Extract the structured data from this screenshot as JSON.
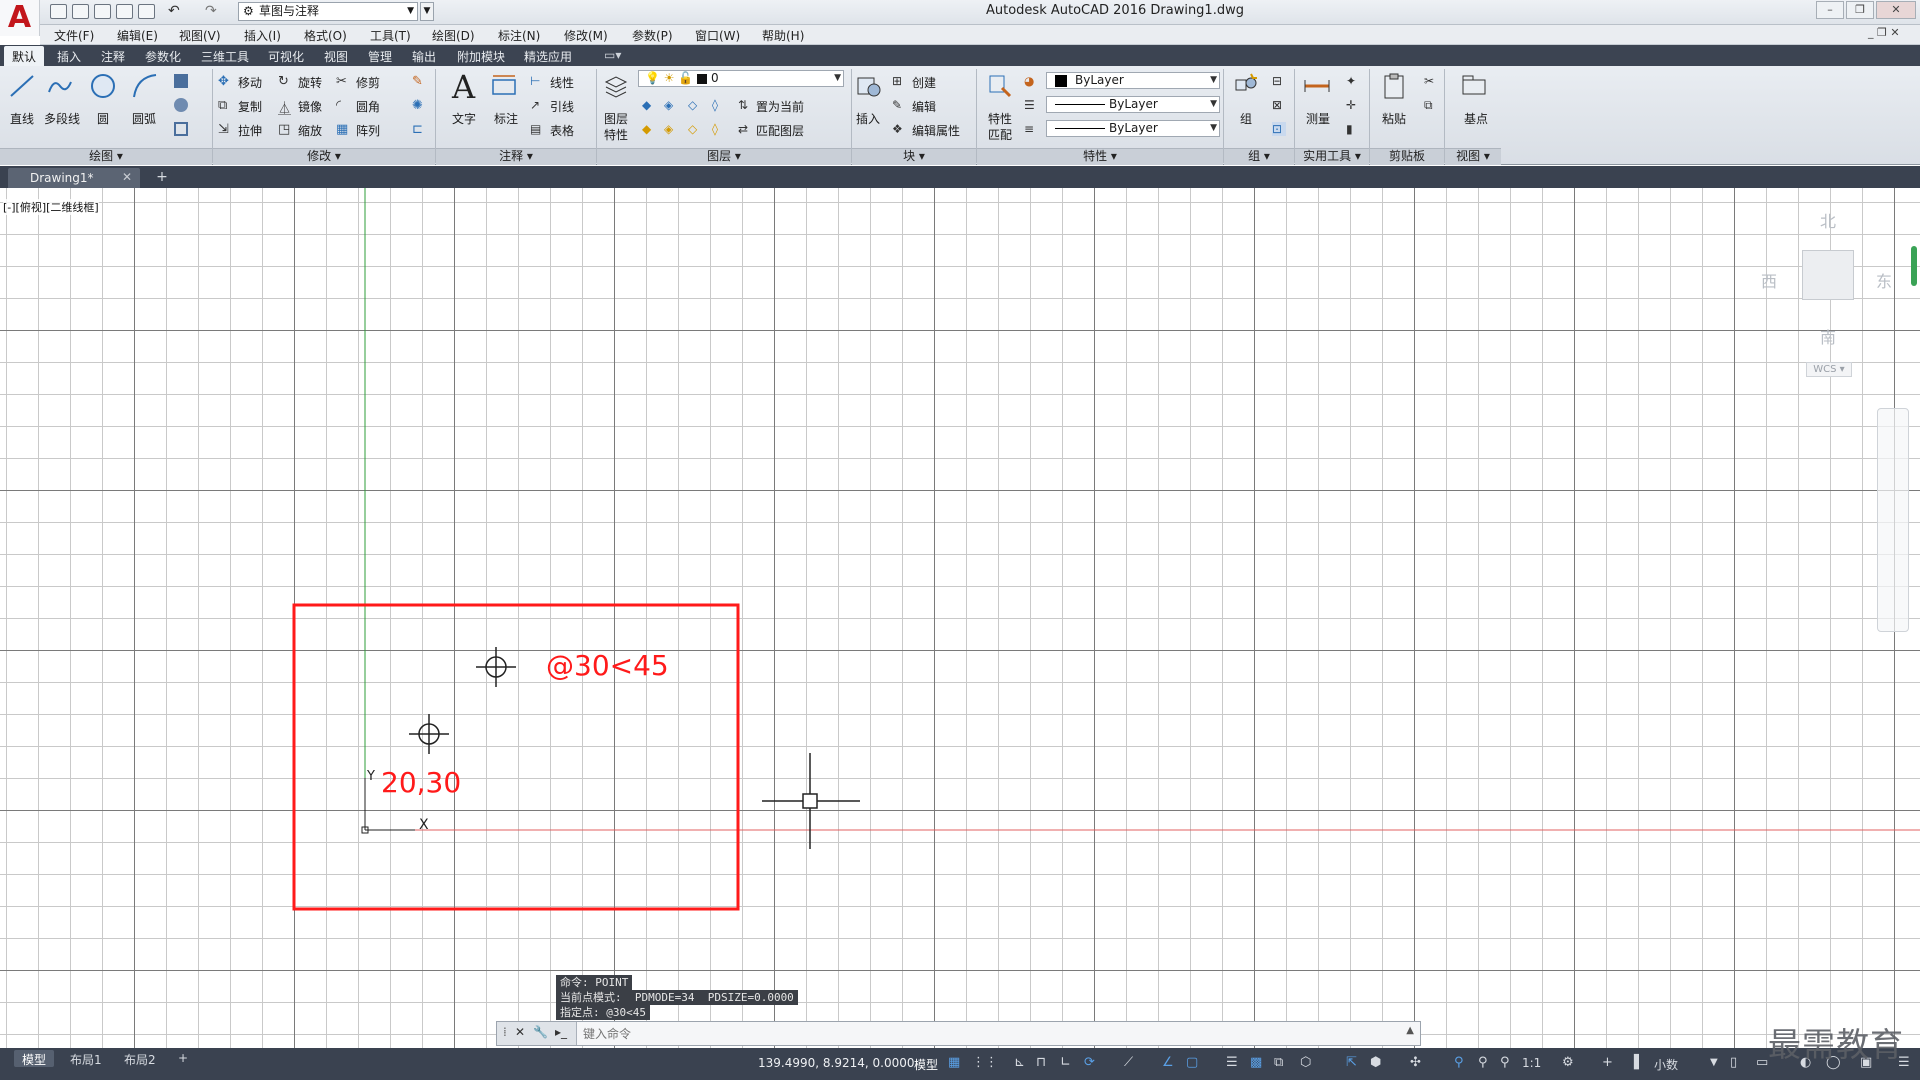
{
  "window": {
    "title": "Autodesk AutoCAD 2016    Drawing1.dwg",
    "workspace": "草图与注释"
  },
  "menu": [
    "文件(F)",
    "编辑(E)",
    "视图(V)",
    "插入(I)",
    "格式(O)",
    "工具(T)",
    "绘图(D)",
    "标注(N)",
    "修改(M)",
    "参数(P)",
    "窗口(W)",
    "帮助(H)"
  ],
  "ribbon_tabs": [
    "默认",
    "插入",
    "注释",
    "参数化",
    "三维工具",
    "可视化",
    "视图",
    "管理",
    "输出",
    "附加模块",
    "精选应用"
  ],
  "ribbon": {
    "draw": {
      "title": "绘图",
      "line": "直线",
      "polyline": "多段线",
      "circle": "圆",
      "arc": "圆弧"
    },
    "modify": {
      "title": "修改",
      "move": "移动",
      "rotate": "旋转",
      "trim": "修剪",
      "copy": "复制",
      "mirror": "镜像",
      "fillet": "圆角",
      "stretch": "拉伸",
      "scale": "缩放",
      "array": "阵列"
    },
    "annotation": {
      "title": "注释",
      "text": "文字",
      "dimension": "标注",
      "linear": "线性",
      "leader": "引线",
      "table": "表格"
    },
    "layers": {
      "title": "图层",
      "props": "图层\n特性",
      "props_l1": "图层",
      "props_l2": "特性",
      "current_layer": "0",
      "make_current": "置为当前",
      "match": "匹配图层"
    },
    "block": {
      "title": "块",
      "insert": "插入",
      "create": "创建",
      "edit": "编辑",
      "edit_attr": "编辑属性"
    },
    "properties": {
      "title": "特性",
      "match_l1": "特性",
      "match_l2": "匹配",
      "color": "ByLayer",
      "linetype": "ByLayer",
      "lineweight": "ByLayer"
    },
    "groups": {
      "title": "组",
      "group": "组"
    },
    "utilities": {
      "title": "实用工具",
      "measure": "测量"
    },
    "clipboard": {
      "title": "剪贴板",
      "paste": "粘贴"
    },
    "view": {
      "title": "视图",
      "base": "基点"
    }
  },
  "doc_tab": "Drawing1*",
  "viewport_label": "[-][俯视][二维线框]",
  "viewcube": {
    "north": "北",
    "south": "南",
    "east": "东",
    "west": "西",
    "wcs": "WCS"
  },
  "annotations": {
    "polar_point": "@30<45",
    "abs_point": "20,30"
  },
  "ucs": {
    "x": "X",
    "y": "Y"
  },
  "command_history": [
    "命令: POINT",
    "当前点模式:  PDMODE=34  PDSIZE=0.0000",
    "指定点: @30<45"
  ],
  "command_input_placeholder": "键入命令",
  "layout_tabs": [
    "模型",
    "布局1",
    "布局2"
  ],
  "status": {
    "coords": "139.4990, 8.9214, 0.0000",
    "model": "模型",
    "scale": "1:1",
    "units": "小数"
  },
  "watermark": "最需教育",
  "colors": {
    "annotation_red": "#ff1a1a",
    "ucs_y_axis": "#2e9c3a",
    "ucs_x_axis": "#e06060"
  }
}
